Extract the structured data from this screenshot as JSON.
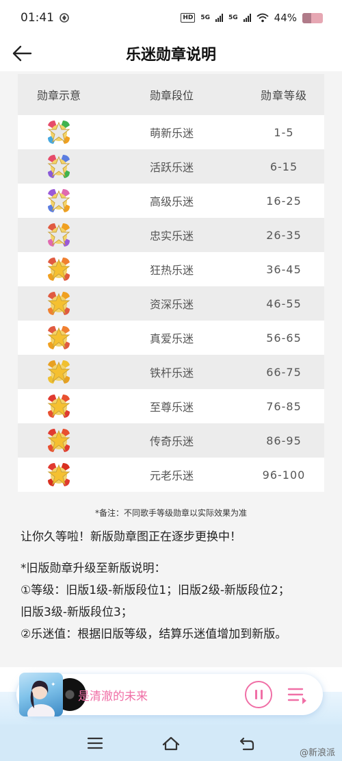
{
  "status_bar": {
    "time": "01:41",
    "hd_badge": "HD",
    "network_1": "5G",
    "network_2": "5G",
    "battery_percent": "44%",
    "battery_level": 0.44
  },
  "header": {
    "title": "乐迷勋章说明",
    "back_icon": "arrow-left-icon"
  },
  "table": {
    "headers": [
      "勋章示意",
      "勋章段位",
      "勋章等级"
    ],
    "rows": [
      {
        "name": "萌新乐迷",
        "level": "1-5",
        "star_color": "#e8e8e8",
        "petal_colors": [
          "#e64b6a",
          "#3fb34f",
          "#f0a020",
          "#44a8e0"
        ]
      },
      {
        "name": "活跃乐迷",
        "level": "6-15",
        "star_color": "#e8e8e8",
        "petal_colors": [
          "#e64b6a",
          "#5b7de0",
          "#3fb34f",
          "#8a5ad8"
        ]
      },
      {
        "name": "高级乐迷",
        "level": "16-25",
        "star_color": "#e8e8e8",
        "petal_colors": [
          "#9a5ad8",
          "#e06ab0",
          "#f0a020",
          "#5b7de0"
        ]
      },
      {
        "name": "忠实乐迷",
        "level": "26-35",
        "star_color": "#e8e8e8",
        "petal_colors": [
          "#e05a40",
          "#f0a020",
          "#9a5ad8",
          "#e06ab0"
        ]
      },
      {
        "name": "狂热乐迷",
        "level": "36-45",
        "star_color": "#f5c030",
        "petal_colors": [
          "#e05a40",
          "#f08030",
          "#e05a40",
          "#f0a020"
        ]
      },
      {
        "name": "资深乐迷",
        "level": "46-55",
        "star_color": "#f5c030",
        "petal_colors": [
          "#e05a40",
          "#f0a020",
          "#e05a40",
          "#f08030"
        ]
      },
      {
        "name": "真爱乐迷",
        "level": "56-65",
        "star_color": "#f5c030",
        "petal_colors": [
          "#e05a40",
          "#f08030",
          "#e05a40",
          "#f0a020"
        ]
      },
      {
        "name": "铁杆乐迷",
        "level": "66-75",
        "star_color": "#f5c030",
        "petal_colors": [
          "#e8a020",
          "#f0c030",
          "#e8a020",
          "#f0c030"
        ]
      },
      {
        "name": "至尊乐迷",
        "level": "76-85",
        "star_color": "#f5c030",
        "petal_colors": [
          "#e03a30",
          "#e85030",
          "#e03a30",
          "#e85030"
        ]
      },
      {
        "name": "传奇乐迷",
        "level": "86-95",
        "star_color": "#f5c030",
        "petal_colors": [
          "#e03a30",
          "#e85030",
          "#e03a30",
          "#e85030"
        ]
      },
      {
        "name": "元老乐迷",
        "level": "96-100",
        "star_color": "#f5c030",
        "petal_colors": [
          "#e03a30",
          "#d83020",
          "#e03a30",
          "#d83020"
        ]
      }
    ]
  },
  "note": "*备注：不同歌手等级勋章以实际效果为准",
  "notice": "让你久等啦！新版勋章图正在逐步更换中！",
  "upgrade": {
    "heading": "*旧版勋章升级至新版说明：",
    "line1": "①等级：旧版1级-新版段位1；旧版2级-新版段位2；",
    "line2": "旧版3级-新版段位3；",
    "line3": "②乐迷值：根据旧版等级，结算乐迷值增加到新版。"
  },
  "player": {
    "song_title": "是清澈的未来",
    "album_icon": "album-cover-image",
    "play_icon": "pause-icon",
    "playlist_icon": "playlist-icon"
  },
  "nav": {
    "menu_icon": "menu-icon",
    "home_icon": "home-icon",
    "back_icon": "back-icon"
  },
  "watermark": "@新浪派"
}
